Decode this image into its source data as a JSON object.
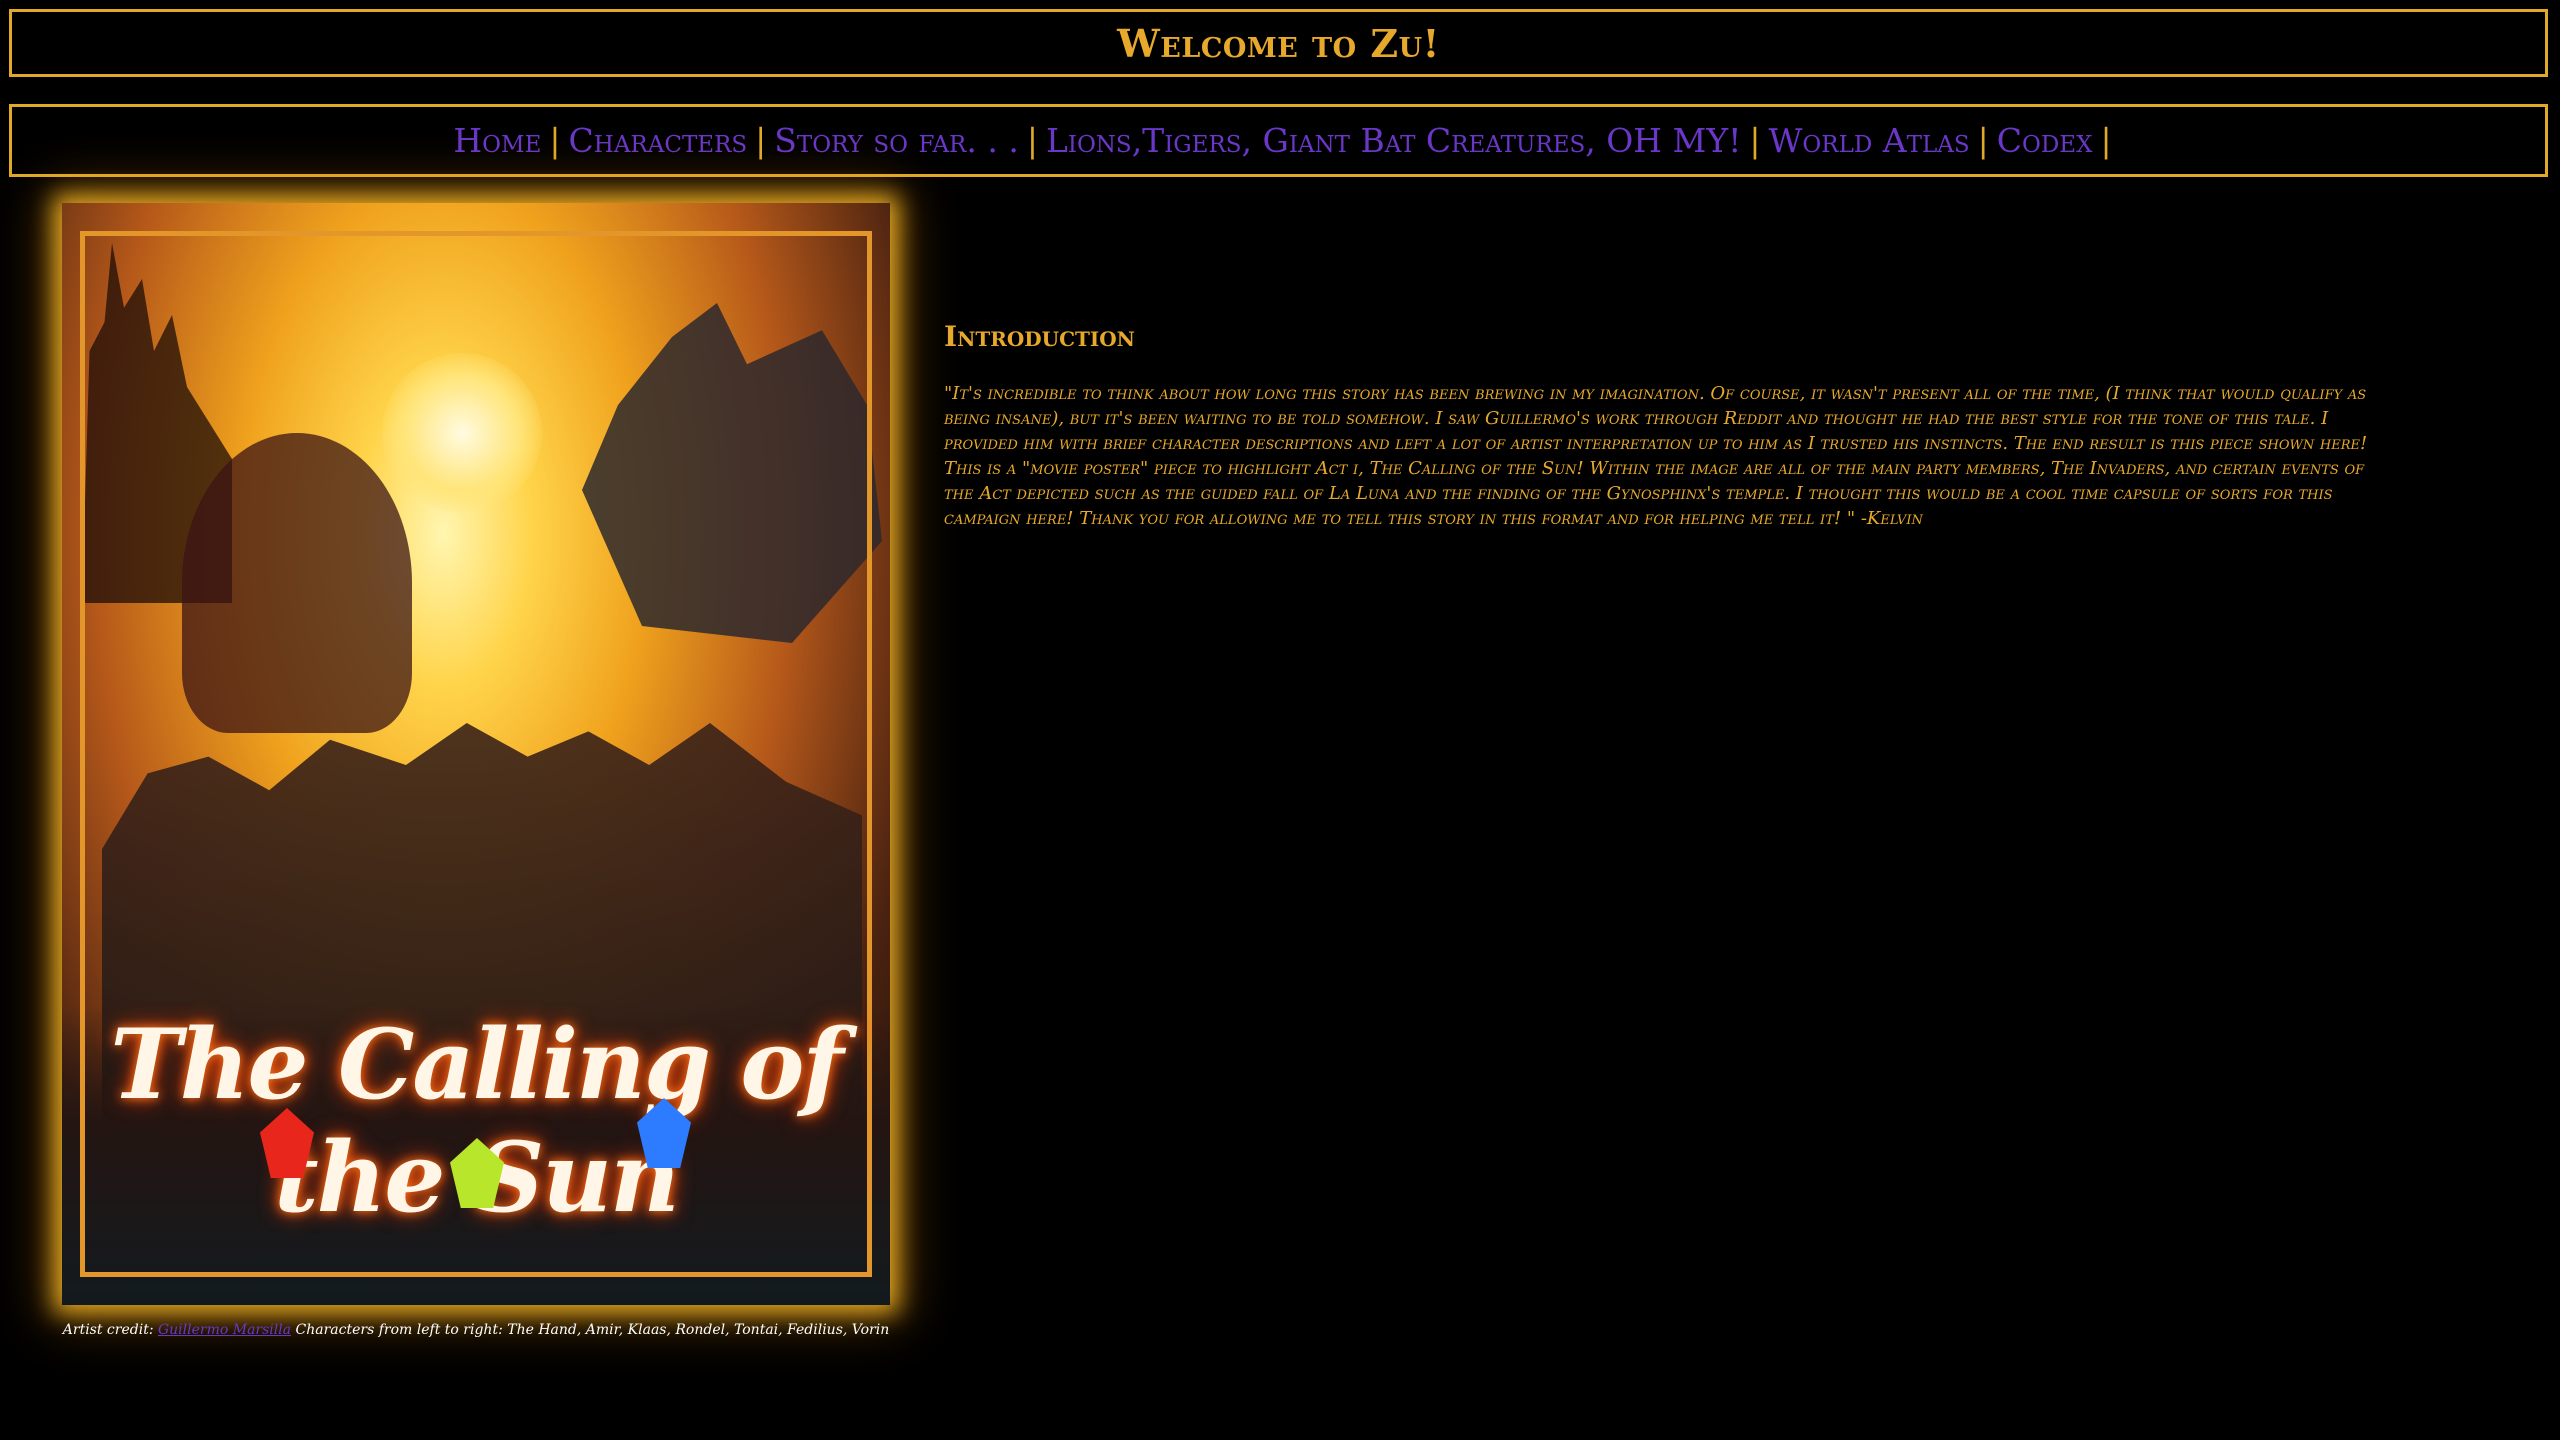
{
  "header": {
    "title": "Welcome to Zu!"
  },
  "nav": {
    "items": [
      {
        "label": "Home"
      },
      {
        "label": "Characters"
      },
      {
        "label": "Story so far. . ."
      },
      {
        "label": "Lions,Tigers, Giant Bat Creatures, OH MY!"
      },
      {
        "label": "World Atlas"
      },
      {
        "label": "Codex"
      }
    ],
    "separator": "|"
  },
  "poster": {
    "title": "The Calling of the Sun"
  },
  "caption": {
    "prefix": "Artist credit: ",
    "artist": "Guillermo Marsilla",
    "characters": " Characters from left to right: The Hand, Amir, Klaas, Rondel, Tontai, Fedilius, Vorin"
  },
  "intro": {
    "heading": "Introduction",
    "text": "\"It's incredible to think about how long this story has been brewing in my imagination. Of course, it wasn't present all of the time, (I think that would qualify as being insane), but it's been waiting to be told somehow. I saw Guillermo's work through Reddit and thought he had the best style for the tone of this tale. I provided him with brief character descriptions and left a lot of artist interpretation up to him as I trusted his instincts. The end result is this piece shown here! This is a \"movie poster\" piece to highlight Act i, The Calling of the Sun! Within the image are all of the main party members, The Invaders, and certain events of the Act depicted such as the guided fall of La Luna and the finding of the Gynosphinx's temple. I thought this would be a cool time capsule of sorts for this campaign here! Thank you for allowing me to tell this story in this format and for helping me tell it! \" -Kelvin"
  },
  "colors": {
    "accent": "#e0a92a",
    "link": "#6a37c9",
    "background": "#000000"
  }
}
